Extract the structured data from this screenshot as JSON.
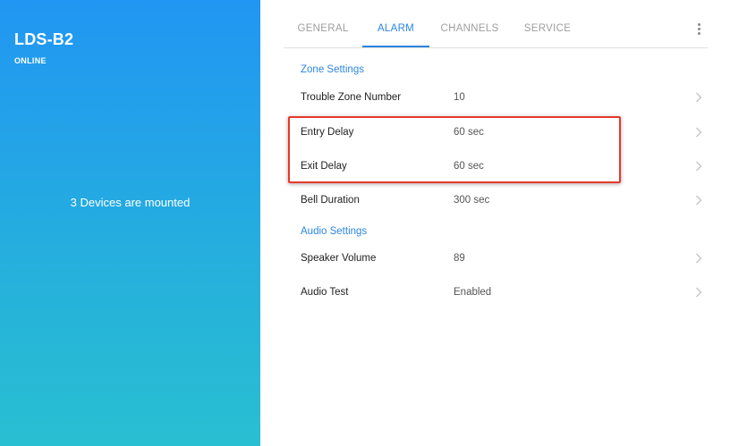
{
  "device": {
    "name": "LDS-B2",
    "status": "ONLINE",
    "mounted_text": "3 Devices are mounted"
  },
  "tabs": [
    {
      "label": "GENERAL",
      "active": false
    },
    {
      "label": "ALARM",
      "active": true
    },
    {
      "label": "CHANNELS",
      "active": false
    },
    {
      "label": "SERVICE",
      "active": false
    }
  ],
  "more_menu_icon": "more-vertical-icon",
  "zone_settings": {
    "header": "Zone Settings",
    "rows": [
      {
        "label": "Trouble Zone Number",
        "value": "10"
      },
      {
        "label": "Entry Delay",
        "value": "60 sec"
      },
      {
        "label": "Exit Delay",
        "value": "60 sec"
      },
      {
        "label": "Bell Duration",
        "value": "300 sec"
      }
    ]
  },
  "audio_settings": {
    "header": "Audio Settings",
    "rows": [
      {
        "label": "Speaker Volume",
        "value": "89"
      },
      {
        "label": "Audio Test",
        "value": "Enabled"
      }
    ]
  },
  "row_chevron_icon": "chevron-right-icon",
  "colors": {
    "accent": "#2d86e0",
    "panel_gradient_top": "#2196f3",
    "panel_gradient_bottom": "#29bfd2",
    "highlight": "#e5382b"
  }
}
